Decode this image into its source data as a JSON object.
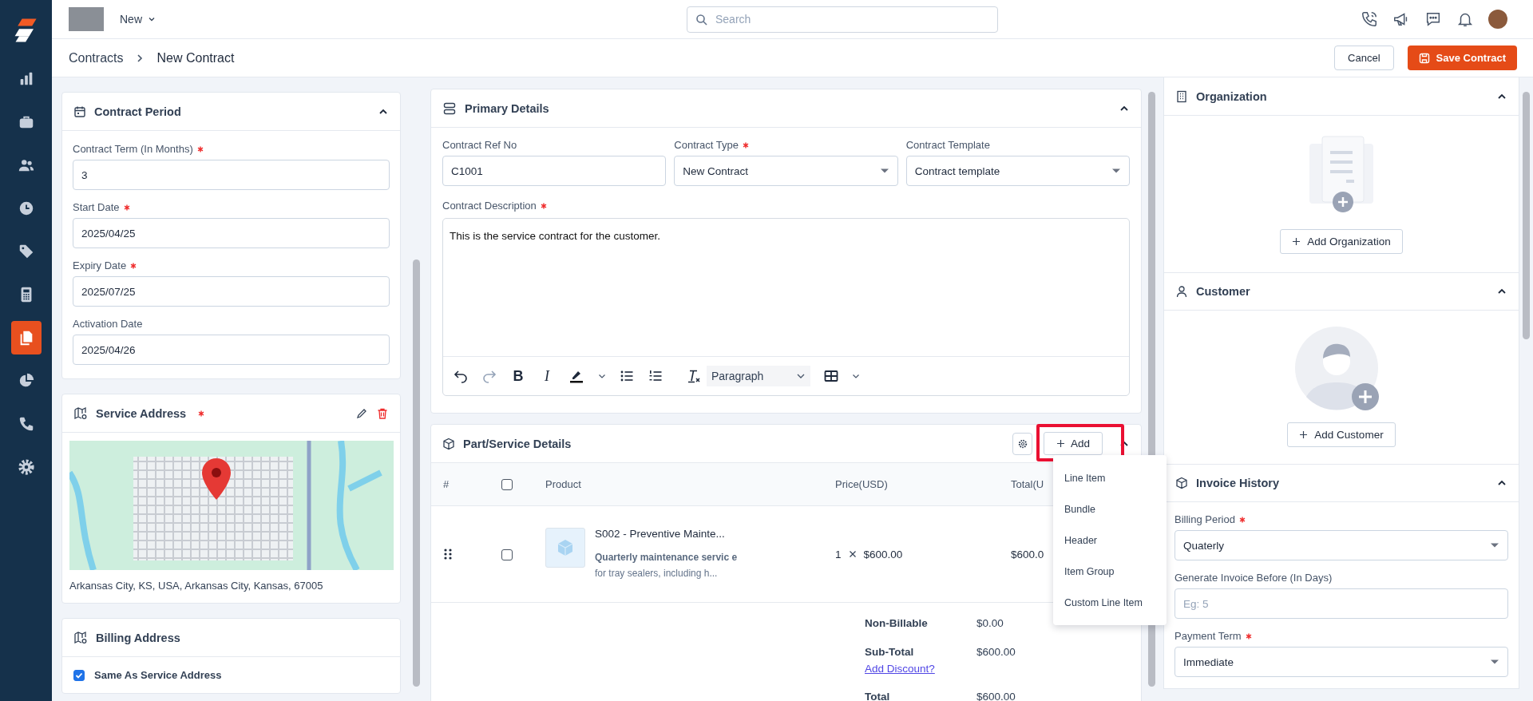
{
  "topbar": {
    "menu_label": "New",
    "search": {
      "placeholder": "Search"
    }
  },
  "sidebar": {
    "items": [
      {
        "selected": false
      },
      {
        "selected": false
      },
      {
        "selected": false
      },
      {
        "selected": false
      },
      {
        "selected": false
      },
      {
        "selected": false
      },
      {
        "selected": true
      },
      {
        "selected": false
      },
      {
        "selected": false
      },
      {
        "selected": false
      }
    ]
  },
  "breadcrumb": [
    "Contracts",
    "New Contract"
  ],
  "actions": {
    "cancel": "Cancel",
    "save": "Save Contract"
  },
  "contract_period": {
    "title": "Contract Period",
    "expanded": true,
    "fields": [
      {
        "label": "Contract Term (In Months)",
        "required": true,
        "value": "3"
      },
      {
        "label": "Start Date",
        "required": true,
        "value": "2025/04/25"
      },
      {
        "label": "Expiry Date",
        "required": true,
        "value": "2025/07/25"
      },
      {
        "label": "Activation Date",
        "required": false,
        "value": "2025/04/26"
      }
    ]
  },
  "service_address": {
    "title": "Service Address",
    "required": true,
    "address": "Arkansas City, KS, USA, Arkansas City, Kansas, 67005"
  },
  "billing_address": {
    "title": "Billing Address",
    "same_as_service": {
      "label": "Same As Service Address",
      "checked": true
    }
  },
  "primary_details": {
    "title": "Primary Details",
    "expanded": true,
    "fields": [
      {
        "kind": "input",
        "label": "Contract Ref No",
        "required": false,
        "value": "C1001"
      },
      {
        "kind": "select",
        "label": "Contract Type",
        "required": true,
        "value": "New Contract"
      },
      {
        "kind": "select",
        "label": "Contract Template",
        "required": false,
        "value": "Contract template"
      }
    ],
    "description": {
      "label": "Contract Description",
      "required": true,
      "value": "This is the service contract for the customer."
    },
    "editor": {
      "bold_label": "B",
      "italic_label": "I",
      "block_format": "Paragraph"
    }
  },
  "parts": {
    "title": "Part/Service Details",
    "expanded": true,
    "add_button": {
      "label": "Add",
      "highlighted": true
    },
    "columns": [
      "#",
      "Product",
      "Price(USD)",
      "Total(U"
    ],
    "header_checked": false,
    "rows": [
      {
        "checked": false,
        "name": "S002 - Preventive Mainte...",
        "description": "**Quarterly maintenance servic e** for tray sealers, including h...",
        "qty": "1",
        "price": "$600.00",
        "total": "$600.0"
      }
    ],
    "summary": [
      {
        "label": "Non-Billable",
        "value": "$0.00"
      },
      {
        "label": "Sub-Total",
        "value": "$600.00",
        "link": "Add Discount?"
      },
      {
        "label": "Total",
        "value": "$600.00"
      }
    ],
    "add_menu": {
      "open": true,
      "items": [
        "Line Item",
        "Bundle",
        "Header",
        "Item Group",
        "Custom Line Item"
      ]
    }
  },
  "organization": {
    "title": "Organization",
    "expanded": true,
    "button": "Add Organization"
  },
  "customer": {
    "title": "Customer",
    "expanded": true,
    "button": "Add Customer"
  },
  "invoice_history": {
    "title": "Invoice History",
    "expanded": true,
    "fields": [
      {
        "kind": "select",
        "label": "Billing Period",
        "required": true,
        "value": "Quaterly"
      },
      {
        "kind": "input",
        "label": "Generate Invoice Before (In Days)",
        "required": false,
        "placeholder": "Eg: 5"
      },
      {
        "kind": "select",
        "label": "Payment Term",
        "required": true,
        "value": "Immediate"
      }
    ]
  }
}
